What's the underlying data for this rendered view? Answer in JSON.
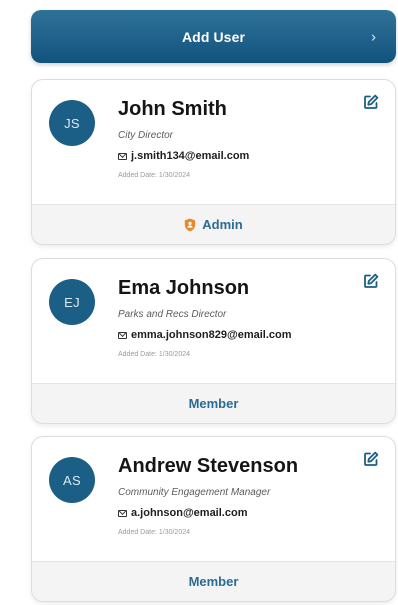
{
  "add_user": {
    "label": "Add User",
    "chevron": "›"
  },
  "users": [
    {
      "initials": "JS",
      "name": "John Smith",
      "title": "City Director",
      "email": "j.smith134@email.com",
      "added": "Added Date: 1/30/2024",
      "role": "Admin",
      "role_icon": "shield-icon"
    },
    {
      "initials": "EJ",
      "name": "Ema Johnson",
      "title": "Parks and Recs Director",
      "email": "emma.johnson829@email.com",
      "added": "Added Date: 1/30/2024",
      "role": "Member"
    },
    {
      "initials": "AS",
      "name": "Andrew Stevenson",
      "title": "Community Engagement Manager",
      "email": "a.johnson@email.com",
      "added": "Added Date: 1/30/2024",
      "role": "Member"
    }
  ],
  "colors": {
    "accent": "#1b5f86",
    "admin": "#e8892b",
    "role_text": "#2c6b93"
  }
}
